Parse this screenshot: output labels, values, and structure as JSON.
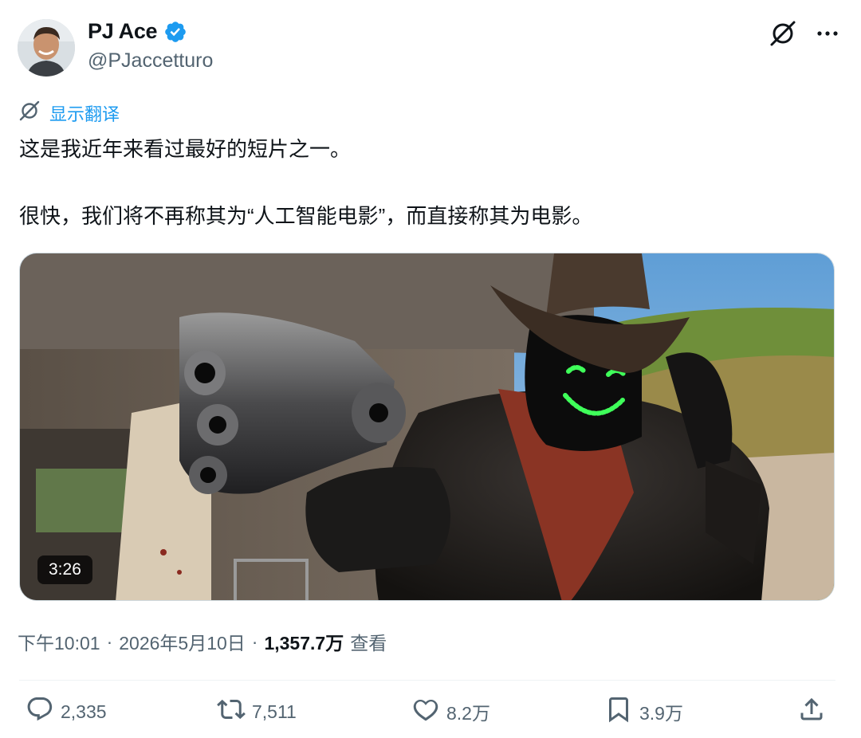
{
  "author": {
    "display_name": "PJ Ace",
    "handle": "@PJaccetturo",
    "verified": true
  },
  "translate": {
    "label": "显示翻译"
  },
  "tweet": {
    "lines": [
      "这是我近年来看过最好的短片之一。",
      "很快，我们将不再称其为“人工智能电影”，而直接称其为电影。"
    ]
  },
  "media": {
    "type": "video",
    "duration": "3:26"
  },
  "meta": {
    "time": "下午10:01",
    "separator": "·",
    "date": "2026年5月10日",
    "views_count": "1,357.7万",
    "views_label": "查看"
  },
  "actions": {
    "replies": "2,335",
    "retweets": "7,511",
    "likes": "8.2万",
    "bookmarks": "3.9万"
  },
  "colors": {
    "accent": "#1d9bf0",
    "secondary_text": "#536471",
    "primary_text": "#0f1419",
    "smile_green": "#3fff5a"
  },
  "icons": [
    "grok-icon",
    "more-icon",
    "verified-badge-icon",
    "translate-icon",
    "reply-icon",
    "retweet-icon",
    "like-icon",
    "bookmark-icon",
    "share-icon"
  ]
}
